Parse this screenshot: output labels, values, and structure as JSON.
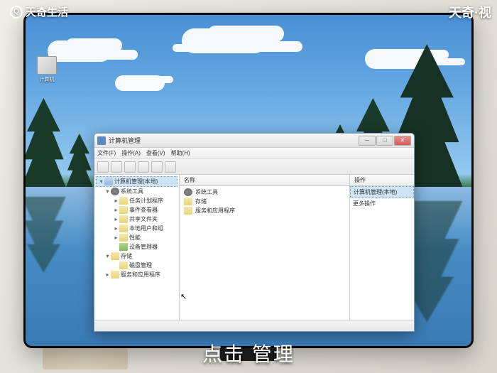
{
  "watermark": {
    "topleft": "天奇生活",
    "topright": "天奇·视"
  },
  "caption": "点击 管理",
  "desktop_icon": {
    "label": "计算机"
  },
  "window": {
    "title": "计算机管理",
    "menu": [
      "文件(F)",
      "操作(A)",
      "查看(V)",
      "帮助(H)"
    ],
    "tree": {
      "root": "计算机管理(本地)",
      "items": [
        {
          "label": "系统工具",
          "icon": "gear"
        },
        {
          "label": "任务计划程序",
          "icon": "folder"
        },
        {
          "label": "事件查看器",
          "icon": "folder"
        },
        {
          "label": "共享文件夹",
          "icon": "folder"
        },
        {
          "label": "本地用户和组",
          "icon": "folder"
        },
        {
          "label": "性能",
          "icon": "folder"
        },
        {
          "label": "设备管理器",
          "icon": "dev"
        },
        {
          "label": "存储",
          "icon": "folder"
        },
        {
          "label": "磁盘管理",
          "icon": "folder"
        },
        {
          "label": "服务和应用程序",
          "icon": "folder"
        }
      ]
    },
    "list": {
      "header_name": "名称",
      "header_action": "操作",
      "items": [
        {
          "label": "系统工具",
          "icon": "gear"
        },
        {
          "label": "存储",
          "icon": "folder"
        },
        {
          "label": "服务和应用程序",
          "icon": "folder"
        }
      ]
    },
    "right": {
      "selected": "计算机管理(本地)",
      "more": "更多操作"
    }
  }
}
